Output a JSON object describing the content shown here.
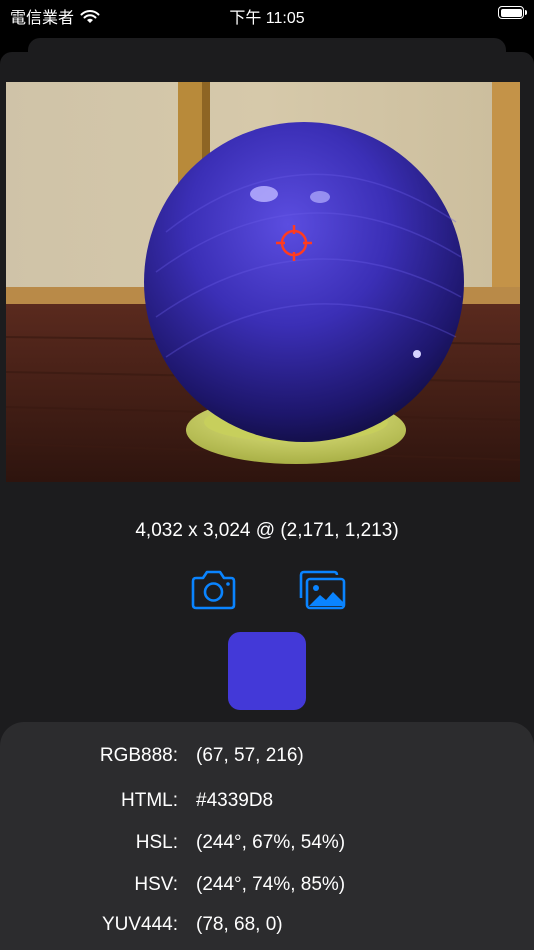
{
  "status_bar": {
    "carrier": "電信業者",
    "time": "下午 11:05"
  },
  "image_info": "4,032 x 3,024 @ (2,171, 1,213)",
  "colors": {
    "accent": "#0A84FF",
    "picked": "#4339D8",
    "crosshair": "#FF3B1F"
  },
  "values": [
    {
      "label": "RGB888:",
      "value": "(67, 57, 216)"
    },
    {
      "label": "HTML:",
      "value": "#4339D8"
    },
    {
      "label": "HSL:",
      "value": "(244°, 67%, 54%)"
    },
    {
      "label": "HSV:",
      "value": "(244°, 74%, 85%)"
    },
    {
      "label": "YUV444:",
      "value": "(78, 68, 0)"
    }
  ],
  "icons": {
    "camera": "camera-icon",
    "library": "photo-library-icon"
  }
}
